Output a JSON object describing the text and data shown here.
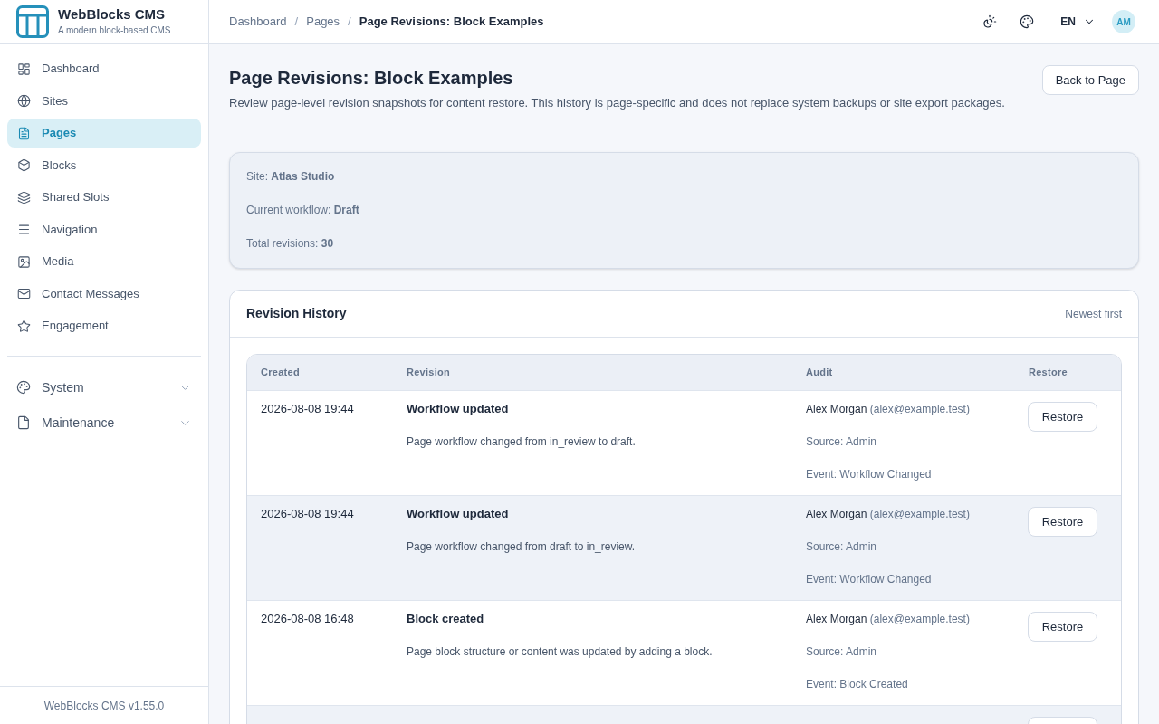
{
  "brand": {
    "name": "WebBlocks CMS",
    "tagline": "A modern block-based CMS"
  },
  "sidebar": {
    "items": [
      {
        "label": "Dashboard",
        "selected": false
      },
      {
        "label": "Sites",
        "selected": false
      },
      {
        "label": "Pages",
        "selected": true
      },
      {
        "label": "Blocks",
        "selected": false
      },
      {
        "label": "Shared Slots",
        "selected": false
      },
      {
        "label": "Navigation",
        "selected": false
      },
      {
        "label": "Media",
        "selected": false
      },
      {
        "label": "Contact Messages",
        "selected": false
      },
      {
        "label": "Engagement",
        "selected": false
      }
    ],
    "groups": [
      {
        "label": "System",
        "expanded": false
      },
      {
        "label": "Maintenance",
        "expanded": false
      }
    ],
    "version": "WebBlocks CMS v1.55.0"
  },
  "header": {
    "breadcrumbs": [
      {
        "kind": "link",
        "label": "Dashboard"
      },
      {
        "kind": "separator",
        "label": "/"
      },
      {
        "kind": "link",
        "label": "Pages"
      },
      {
        "kind": "separator",
        "label": "/"
      },
      {
        "kind": "current",
        "label": "Page Revisions: Block Examples"
      }
    ],
    "language": "EN",
    "avatar": "AM"
  },
  "page": {
    "title": "Page Revisions: Block Examples",
    "description": "Review page-level revision snapshots for content restore. This history is page-specific and does not replace system backups or site export packages.",
    "back_button": "Back to Page"
  },
  "summary": [
    "Site: **Atlas Studio**",
    "Current workflow: **Draft**",
    "Total revisions: **30**"
  ],
  "history": {
    "title": "Revision History",
    "order": "Newest first",
    "columns": [
      "Created",
      "Revision",
      "Audit",
      "Restore"
    ],
    "rows": [
      {
        "created": "2026-08-08 19:44",
        "title": "Workflow updated",
        "description": "Page workflow changed from in_review to draft.",
        "user": "Alex Morgan",
        "email": "(alex@example.test)",
        "source": "Source: Admin",
        "event": "Event: Workflow Changed",
        "action": "Restore"
      },
      {
        "created": "2026-08-08 19:44",
        "title": "Workflow updated",
        "description": "Page workflow changed from draft to in_review.",
        "user": "Alex Morgan",
        "email": "(alex@example.test)",
        "source": "Source: Admin",
        "event": "Event: Workflow Changed",
        "action": "Restore"
      },
      {
        "created": "2026-08-08 16:48",
        "title": "Block created",
        "description": "Page block structure or content was updated by adding a block.",
        "user": "Alex Morgan",
        "email": "(alex@example.test)",
        "source": "Source: Admin",
        "event": "Event: Block Created",
        "action": "Restore"
      },
      {}
    ]
  }
}
